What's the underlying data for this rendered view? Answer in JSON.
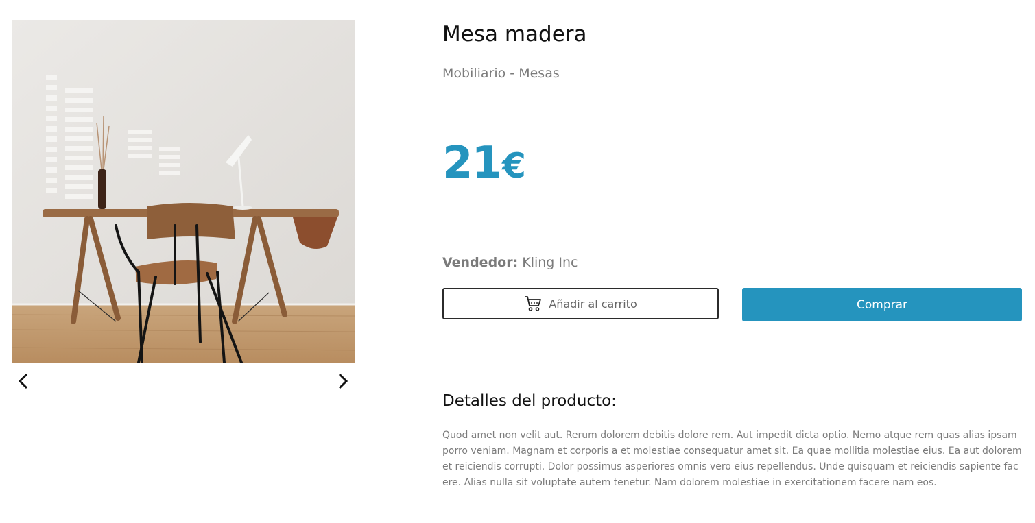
{
  "product": {
    "title": "Mesa madera",
    "category": "Mobiliario - Mesas",
    "price": "21",
    "currency": "€",
    "seller_label": "Vendedor:",
    "seller_name": "Kling Inc",
    "image_alt": "Mesa madera"
  },
  "actions": {
    "add_to_cart_label": "Añadir al carrito",
    "buy_label": "Comprar"
  },
  "gallery": {
    "prev_icon": "chevron-left-icon",
    "next_icon": "chevron-right-icon"
  },
  "details": {
    "heading": "Detalles del producto:",
    "description": "Quod amet non velit aut. Rerum dolorem debitis dolore rem. Aut impedit dicta optio. Nemo atque rem quas alias ipsam porro veniam. Magnam et corporis a et molestiae consequatur amet sit. Ea quae mollitia molestiae eius. Ea aut dolorem et reiciendis corrupti. Dolor possimus asperiores omnis vero eius repellendus. Unde quisquam et reiciendis sapiente facere. Alias nulla sit voluptate autem tenetur. Nam dolorem molestiae in exercitationem facere nam eos."
  },
  "colors": {
    "accent": "#2594be",
    "muted_text": "#7b7b7b",
    "heading_text": "#111111"
  }
}
